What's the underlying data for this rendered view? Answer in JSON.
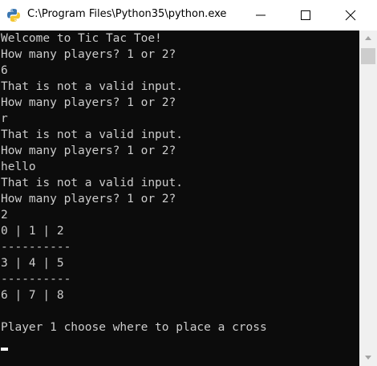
{
  "window": {
    "title": "C:\\Program Files\\Python35\\python.exe",
    "icon": "python-icon",
    "controls": [
      "minimize-icon",
      "maximize-icon",
      "close-icon"
    ]
  },
  "console": {
    "lines": [
      "Welcome to Tic Tac Toe!",
      "How many players? 1 or 2?",
      "6",
      "That is not a valid input.",
      "How many players? 1 or 2?",
      "r",
      "That is not a valid input.",
      "How many players? 1 or 2?",
      "hello",
      "That is not a valid input.",
      "How many players? 1 or 2?",
      "2",
      "0 | 1 | 2",
      "----------",
      "3 | 4 | 5",
      "----------",
      "6 | 7 | 8",
      "",
      "Player 1 choose where to place a cross"
    ],
    "colors": {
      "background": "#0c0c0c",
      "text": "#cccccc"
    }
  },
  "scrollbar": {
    "up_icon": "scroll-up-arrow-icon",
    "down_icon": "scroll-down-arrow-icon"
  }
}
